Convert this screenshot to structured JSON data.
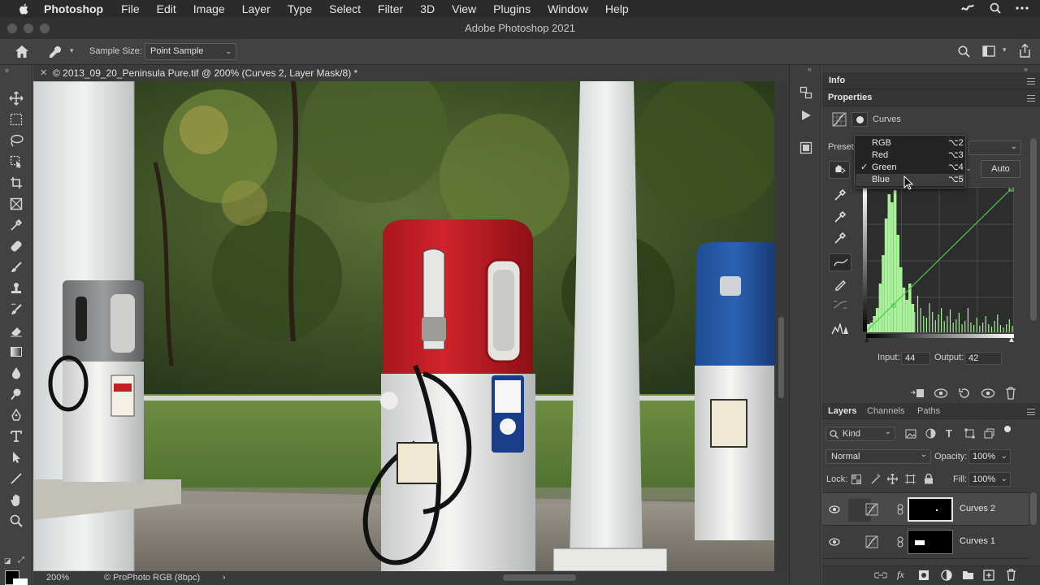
{
  "menubar": {
    "app": "Photoshop",
    "items": [
      "File",
      "Edit",
      "Image",
      "Layer",
      "Type",
      "Select",
      "Filter",
      "3D",
      "View",
      "Plugins",
      "Window",
      "Help"
    ]
  },
  "window": {
    "title": "Adobe Photoshop 2021"
  },
  "options": {
    "sample_size_label": "Sample Size:",
    "sample_size_value": "Point Sample"
  },
  "document": {
    "tab_title": "© 2013_09_20_Peninsula Pure.tif @ 200% (Curves 2, Layer Mask/8) *",
    "zoom": "200%",
    "profile": "© ProPhoto RGB (8bpc)"
  },
  "panels": {
    "info_tab": "Info",
    "properties_tab": "Properties",
    "adjustment_name": "Curves",
    "preset_label": "Preset",
    "auto_button": "Auto",
    "input_label": "Input:",
    "input_value": "44",
    "output_label": "Output:",
    "output_value": "42"
  },
  "channel_menu": {
    "items": [
      {
        "label": "RGB",
        "key": "⌥2",
        "checked": false,
        "highlighted": false
      },
      {
        "label": "Red",
        "key": "⌥3",
        "checked": false,
        "highlighted": false
      },
      {
        "label": "Green",
        "key": "⌥4",
        "checked": true,
        "highlighted": false
      },
      {
        "label": "Blue",
        "key": "⌥5",
        "checked": false,
        "highlighted": true
      }
    ]
  },
  "layers_panel": {
    "tabs": [
      "Layers",
      "Channels",
      "Paths"
    ],
    "filter_kind": "Kind",
    "blend_mode": "Normal",
    "opacity_label": "Opacity:",
    "opacity_value": "100%",
    "lock_label": "Lock:",
    "fill_label": "Fill:",
    "fill_value": "100%",
    "layers": [
      {
        "name": "Curves 2"
      },
      {
        "name": "Curves 1"
      }
    ]
  },
  "colors": {
    "curve_green": "#4cc94c",
    "histogram": "#a8f09a",
    "ui_bg": "#3d3d3d"
  }
}
